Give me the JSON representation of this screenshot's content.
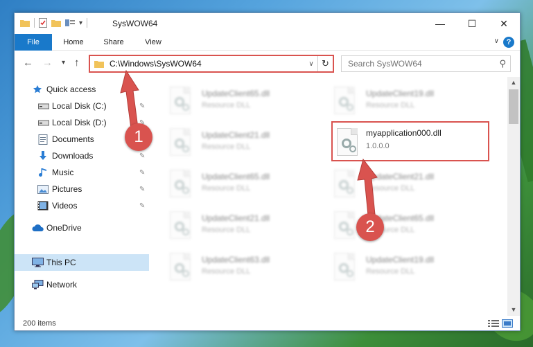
{
  "window": {
    "title": "SysWOW64",
    "minimize_glyph": "—",
    "maximize_glyph": "☐",
    "close_glyph": "✕",
    "qa_dropdown_glyph": "▾"
  },
  "ribbon": {
    "tabs": [
      "File",
      "Home",
      "Share",
      "View"
    ],
    "expand_glyph": "∨",
    "help_glyph": "?"
  },
  "navigation": {
    "back_glyph": "←",
    "forward_glyph": "→",
    "recent_glyph": "▾",
    "up_glyph": "↑",
    "address": "C:\\Windows\\SysWOW64",
    "address_dropdown_glyph": "∨",
    "refresh_glyph": "↻",
    "search_placeholder": "Search SysWOW64",
    "search_glyph": "⚲"
  },
  "sidebar": {
    "items": [
      {
        "label": "Quick access",
        "icon": "star-icon"
      },
      {
        "label": "Local Disk (C:)",
        "icon": "drive-icon",
        "pinned": true
      },
      {
        "label": "Local Disk (D:)",
        "icon": "drive-icon",
        "pinned": true
      },
      {
        "label": "Documents",
        "icon": "documents-icon",
        "pinned": true
      },
      {
        "label": "Downloads",
        "icon": "downloads-icon",
        "pinned": true
      },
      {
        "label": "Music",
        "icon": "music-icon",
        "pinned": true
      },
      {
        "label": "Pictures",
        "icon": "pictures-icon",
        "pinned": true
      },
      {
        "label": "Videos",
        "icon": "videos-icon",
        "pinned": true
      },
      {
        "label": "OneDrive",
        "icon": "cloud-icon"
      },
      {
        "label": "This PC",
        "icon": "computer-icon",
        "selected": true
      },
      {
        "label": "Network",
        "icon": "network-icon"
      }
    ],
    "pin_glyph": "✎"
  },
  "files": [
    {
      "name": "UpdateClient65.dll",
      "type": "Resource DLL",
      "blurred": true
    },
    {
      "name": "UpdateClient19.dll",
      "type": "Resource DLL",
      "blurred": true
    },
    {
      "name": "UpdateClient21.dll",
      "type": "Resource DLL",
      "blurred": true
    },
    {
      "name": "myapplication000.dll",
      "type": "1.0.0.0",
      "blurred": false,
      "highlighted": true
    },
    {
      "name": "UpdateClient65.dll",
      "type": "Resource DLL",
      "blurred": true
    },
    {
      "name": "UpdateClient21.dll",
      "type": "Resource DLL",
      "blurred": true
    },
    {
      "name": "UpdateClient21.dll",
      "type": "Resource DLL",
      "blurred": true
    },
    {
      "name": "UpdateClient65.dll",
      "type": "Resource DLL",
      "blurred": true
    },
    {
      "name": "UpdateClient63.dll",
      "type": "Resource DLL",
      "blurred": true
    },
    {
      "name": "UpdateClient19.dll",
      "type": "Resource DLL",
      "blurred": true
    }
  ],
  "status": {
    "item_count": "200 items"
  },
  "annotations": {
    "step1": "1",
    "step2": "2",
    "color": "#d9534f"
  },
  "colors": {
    "accent": "#1979ca",
    "selection": "#cce4f7",
    "highlight": "#d9534f"
  }
}
